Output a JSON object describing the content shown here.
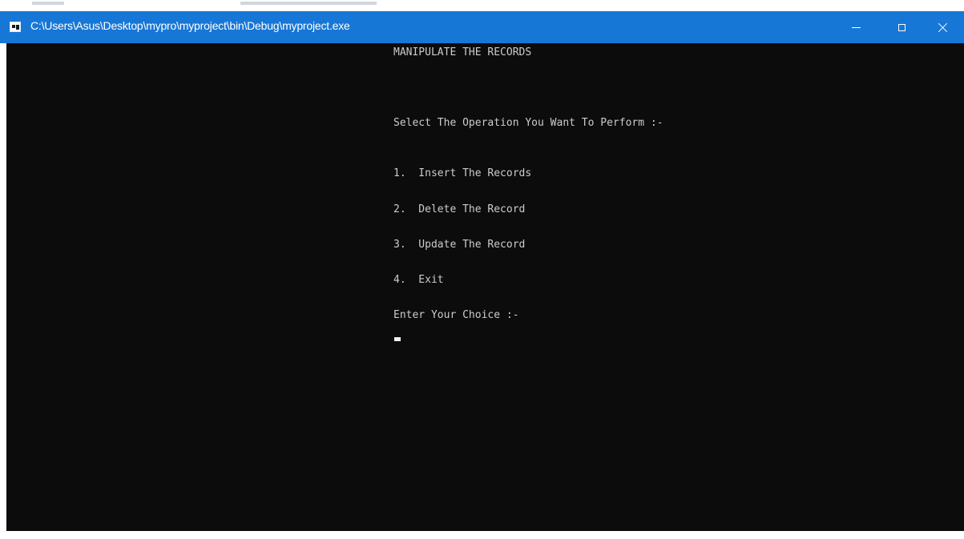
{
  "window": {
    "title": "C:\\Users\\Asus\\Desktop\\mypro\\myproject\\bin\\Debug\\myproject.exe",
    "titlebar_color": "#1777d6",
    "icons": {
      "app": "console-app-icon",
      "minimize": "minimize-icon",
      "maximize": "maximize-icon",
      "close": "close-icon"
    }
  },
  "console": {
    "background": "#0c0c0c",
    "foreground": "#cccccc",
    "heading": "MANIPULATE THE RECORDS",
    "prompt_operation": "Select The Operation You Want To Perform :-",
    "options": [
      "1.  Insert The Records",
      "2.  Delete The Record",
      "3.  Update The Record",
      "4.  Exit"
    ],
    "prompt_choice": "Enter Your Choice :-"
  }
}
